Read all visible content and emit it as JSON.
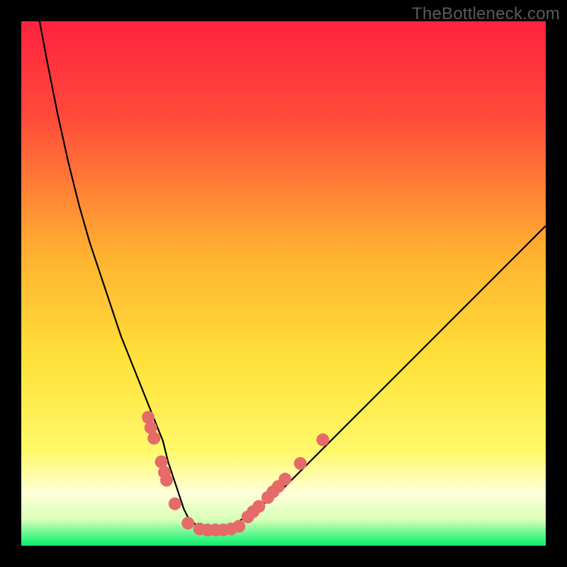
{
  "watermark": "TheBottleneck.com",
  "colors": {
    "bg": "#000000",
    "grad_top": "#ff223f",
    "grad_upper": "#ff5a3a",
    "grad_mid": "#ffcf2a",
    "grad_lower": "#fff85a",
    "grad_pale": "#ffffd0",
    "grad_green": "#2cf57b",
    "curve": "#000000",
    "dot_fill": "#e66a6a",
    "dot_stroke": "#c94f4f"
  },
  "chart_data": {
    "type": "line",
    "title": "",
    "xlabel": "",
    "ylabel": "",
    "xlim": [
      0,
      100
    ],
    "ylim": [
      0,
      100
    ],
    "series": [
      {
        "name": "bottleneck-curve",
        "x": [
          3.5,
          5,
          7,
          9,
          11,
          13,
          15,
          17,
          19,
          21,
          23,
          25,
          27,
          28,
          29,
          30,
          31,
          32,
          34,
          36,
          38,
          40,
          42,
          45,
          50,
          55,
          60,
          65,
          70,
          75,
          80,
          85,
          90,
          95,
          100
        ],
        "y": [
          100,
          92,
          82,
          73,
          65,
          58,
          52,
          46,
          40,
          35,
          30,
          25,
          20,
          16,
          13,
          10,
          7,
          5,
          3.5,
          3,
          3,
          3.5,
          5,
          7,
          11,
          16,
          21,
          26,
          31,
          36,
          41,
          46,
          51,
          56,
          61
        ]
      }
    ],
    "dots_left": [
      {
        "x": 24.2,
        "y": 24.5
      },
      {
        "x": 24.7,
        "y": 22.5
      },
      {
        "x": 25.3,
        "y": 20.5
      },
      {
        "x": 26.7,
        "y": 16.0
      },
      {
        "x": 27.3,
        "y": 14.0
      },
      {
        "x": 27.7,
        "y": 12.5
      },
      {
        "x": 29.3,
        "y": 8.0
      },
      {
        "x": 31.8,
        "y": 4.3
      }
    ],
    "dots_bottom": [
      {
        "x": 34.0,
        "y": 3.2
      },
      {
        "x": 35.5,
        "y": 3.0
      },
      {
        "x": 37.0,
        "y": 3.0
      },
      {
        "x": 38.5,
        "y": 3.0
      },
      {
        "x": 40.0,
        "y": 3.2
      },
      {
        "x": 41.5,
        "y": 3.7
      }
    ],
    "dots_right": [
      {
        "x": 43.2,
        "y": 5.5
      },
      {
        "x": 44.2,
        "y": 6.5
      },
      {
        "x": 45.3,
        "y": 7.5
      },
      {
        "x": 47.0,
        "y": 9.2
      },
      {
        "x": 48.0,
        "y": 10.3
      },
      {
        "x": 49.0,
        "y": 11.3
      },
      {
        "x": 50.3,
        "y": 12.7
      },
      {
        "x": 53.2,
        "y": 15.7
      },
      {
        "x": 57.5,
        "y": 20.2
      }
    ]
  }
}
